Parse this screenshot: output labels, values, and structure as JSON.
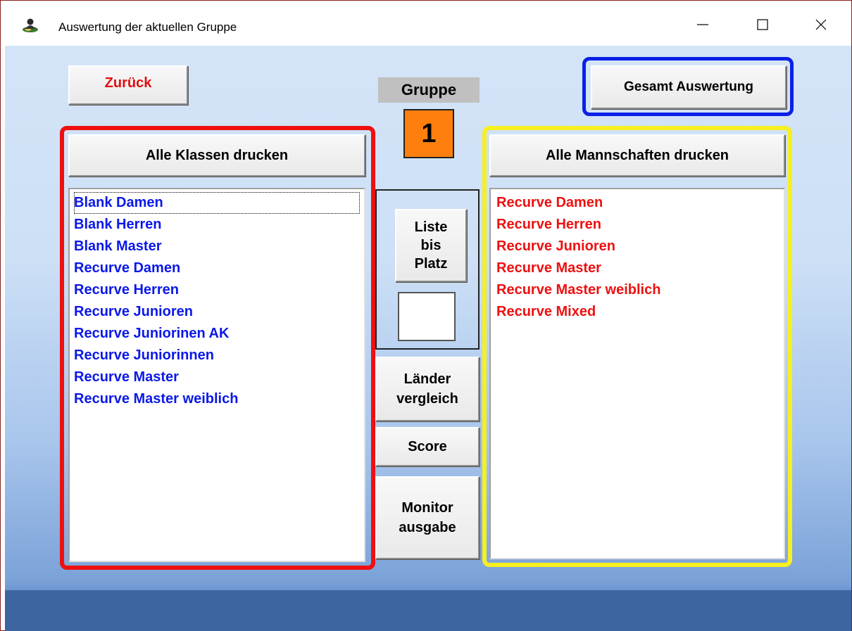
{
  "window": {
    "title": "Auswertung der aktuellen Gruppe",
    "app_icon": "user-globe-icon",
    "controls": {
      "minimize_icon": "minimize-icon",
      "maximize_icon": "maximize-icon",
      "close_icon": "close-icon"
    }
  },
  "toolbar": {
    "back_label": "Zurück",
    "overall_label": "Gesamt Auswertung"
  },
  "group": {
    "label": "Gruppe",
    "value": "1"
  },
  "classes": {
    "print_all_label": "Alle Klassen drucken",
    "items": [
      "Blank Damen",
      "Blank Herren",
      "Blank Master",
      "Recurve Damen",
      "Recurve Herren",
      "Recurve Junioren",
      "Recurve Juniorinen AK",
      "Recurve Juniorinnen",
      "Recurve Master",
      "Recurve Master weiblich"
    ]
  },
  "teams": {
    "print_all_label": "Alle Mannschaften drucken",
    "items": [
      "Recurve Damen",
      "Recurve Herren",
      "Recurve Junioren",
      "Recurve Master",
      "Recurve Master weiblich",
      "Recurve Mixed"
    ]
  },
  "middle": {
    "list_until": [
      "Liste",
      "bis",
      "Platz"
    ],
    "place_value": "",
    "country_compare": [
      "Länder",
      "vergleich"
    ],
    "score_label": "Score",
    "monitor_output": [
      "Monitor",
      "ausgabe"
    ]
  },
  "colors": {
    "class_text": "#0a18e8",
    "team_text": "#ee1010",
    "group_value_bg": "#ff7f0e",
    "red_frame": "#ee1010",
    "yellow_frame": "#f6f020",
    "blue_frame": "#0a20e6"
  }
}
